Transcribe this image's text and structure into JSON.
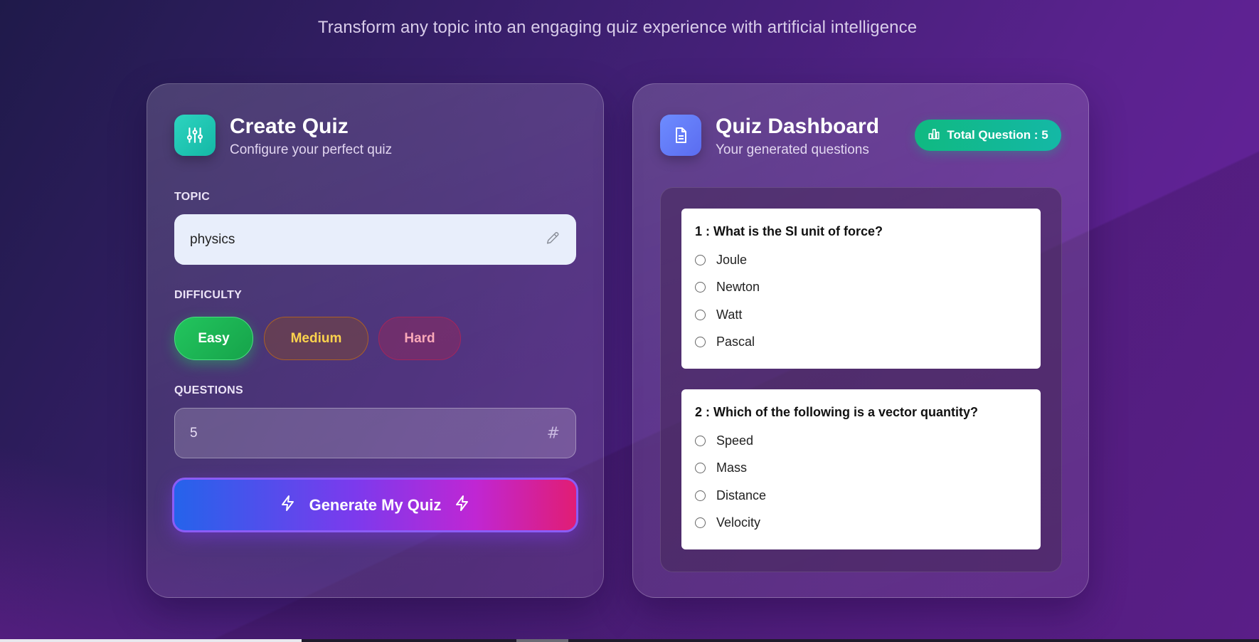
{
  "tagline": "Transform any topic into an engaging quiz experience with artificial intelligence",
  "create": {
    "title": "Create Quiz",
    "subtitle": "Configure your perfect quiz",
    "topic_label": "TOPIC",
    "topic_value": "physics",
    "difficulty_label": "DIFFICULTY",
    "difficulties": [
      "Easy",
      "Medium",
      "Hard"
    ],
    "selected_difficulty": "Easy",
    "questions_label": "QUESTIONS",
    "questions_value": "5",
    "generate_label": "Generate My Quiz"
  },
  "dashboard": {
    "title": "Quiz Dashboard",
    "subtitle": "Your generated questions",
    "total_label": "Total Question : 5",
    "questions": [
      {
        "text": "1 : What is the SI unit of force?",
        "options": [
          "Joule",
          "Newton",
          "Watt",
          "Pascal"
        ]
      },
      {
        "text": "2 : Which of the following is a vector quantity?",
        "options": [
          "Speed",
          "Mass",
          "Distance",
          "Velocity"
        ]
      }
    ]
  },
  "colors": {
    "accent_teal": "#14b8a6",
    "easy_green": "#22c55e",
    "medium_amber": "#fcd34d",
    "hard_rose": "#f9a8b8",
    "generate_start": "#2563eb",
    "generate_end": "#e11d74"
  },
  "icons": {
    "create_header": "sliders-icon",
    "dashboard_header": "document-icon",
    "topic_field": "pencil-icon",
    "questions_field": "hash-icon",
    "generate": "bolt-icon",
    "total_badge": "bar-chart-icon"
  }
}
